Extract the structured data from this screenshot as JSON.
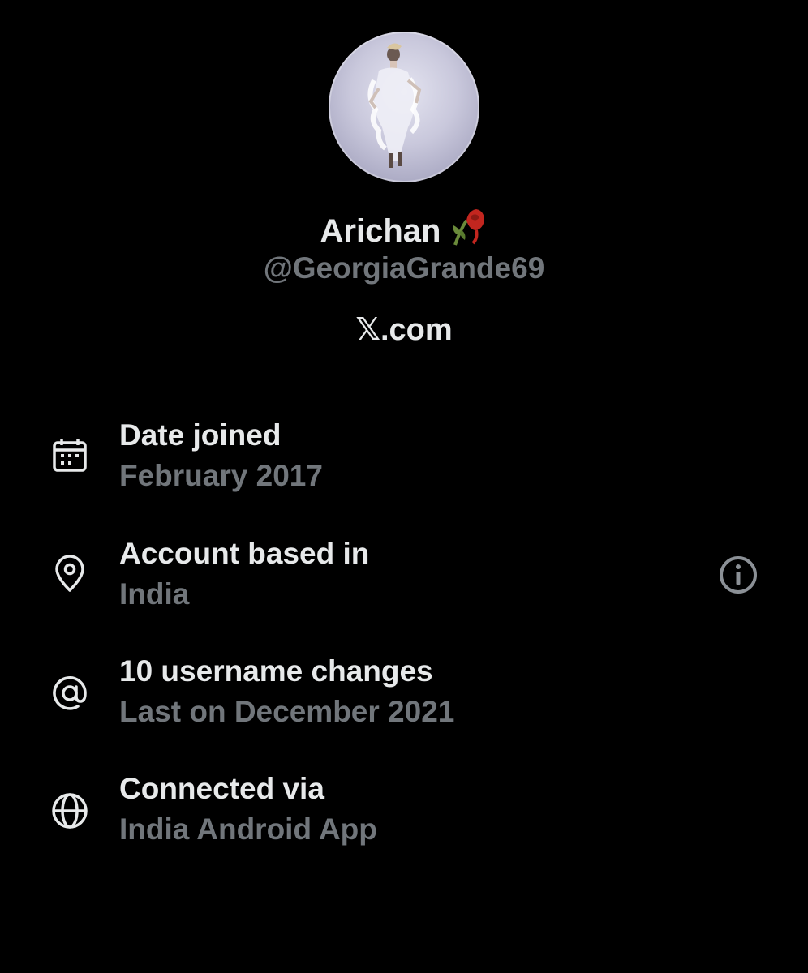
{
  "profile": {
    "display_name": "Arichan",
    "name_emoji": "wilted-rose-icon",
    "handle": "@GeorgiaGrande69",
    "site": "𝕏.com"
  },
  "details": [
    {
      "icon": "calendar-icon",
      "title": "Date joined",
      "value": "February 2017"
    },
    {
      "icon": "location-pin-icon",
      "title": "Account based in",
      "value": "India",
      "info": "info-icon"
    },
    {
      "icon": "at-sign-icon",
      "title": "10 username changes",
      "value": "Last on December 2021"
    },
    {
      "icon": "globe-icon",
      "title": "Connected via",
      "value": "India Android App"
    }
  ],
  "colors": {
    "background": "#000000",
    "primary_text": "#e7e9ea",
    "secondary_text": "#71767b",
    "rose": "#c2261f",
    "stem": "#6a8a3a"
  }
}
